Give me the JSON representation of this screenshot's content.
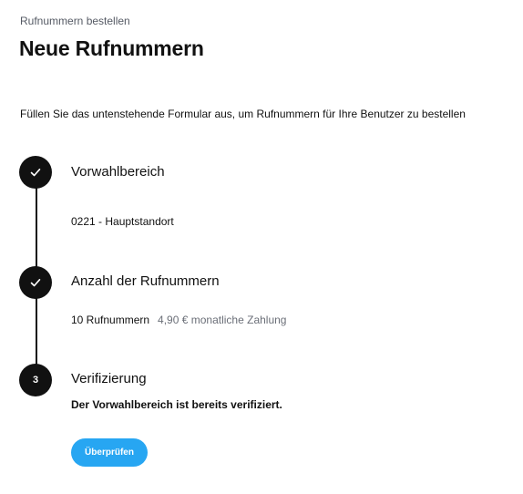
{
  "breadcrumb": "Rufnummern bestellen",
  "title": "Neue Rufnummern",
  "intro": "Füllen Sie das untenstehende Formular aus, um Rufnummern für Ihre Benutzer zu bestellen",
  "steps": [
    {
      "status": "done",
      "icon": "check-icon",
      "title": "Vorwahlbereich",
      "value": "0221 - Hauptstandort"
    },
    {
      "status": "done",
      "icon": "check-icon",
      "title": "Anzahl der Rufnummern",
      "value": "10 Rufnummern",
      "detail": "4,90 € monatliche Zahlung"
    },
    {
      "status": "active",
      "number": "3",
      "title": "Verifizierung",
      "message": "Der Vorwahlbereich ist bereits verifiziert.",
      "button_label": "Überprüfen"
    }
  ],
  "colors": {
    "step_circle": "#111111",
    "primary_button": "#27a6f2"
  }
}
